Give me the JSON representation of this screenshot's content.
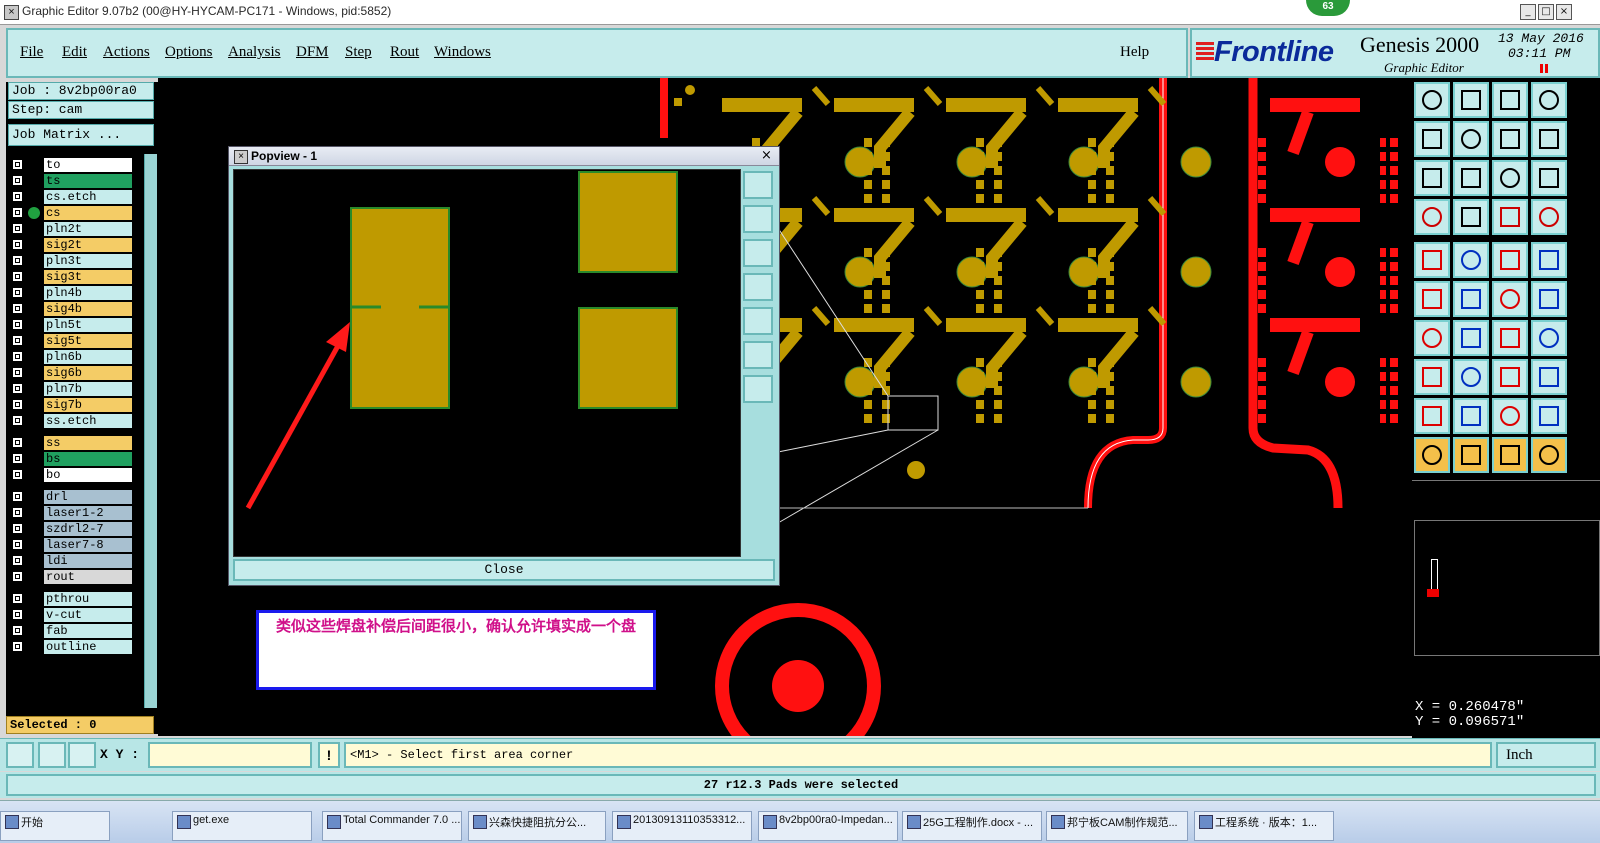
{
  "window": {
    "title": "Graphic Editor 9.07b2 (00@HY-HYCAM-PC171 - Windows, pid:5852)",
    "badge": "63",
    "minimize_glyph": "_",
    "maximize_glyph": "□",
    "close_glyph": "×"
  },
  "menu": {
    "items": [
      "File",
      "Edit",
      "Actions",
      "Options",
      "Analysis",
      "DFM",
      "Step",
      "Rout",
      "Windows"
    ],
    "help": "Help"
  },
  "brand": {
    "logo": "Frontline",
    "product": "Genesis 2000",
    "subtitle": "Graphic Editor",
    "date_line1": "13 May 2016",
    "date_line2": "03:11 PM"
  },
  "job": {
    "job_label": "Job : 8v2bp00ra0",
    "step_label": "Step: cam",
    "matrix_button": "Job Matrix ..."
  },
  "layers": [
    {
      "name": "to",
      "color": "#ffffff"
    },
    {
      "name": "ts",
      "color": "#20a060"
    },
    {
      "name": "cs.etch",
      "color": "#c6ecec"
    },
    {
      "name": "cs",
      "color": "#f4cc66",
      "active": true
    },
    {
      "name": "pln2t",
      "color": "#c6ecec"
    },
    {
      "name": "sig2t",
      "color": "#f4cc66"
    },
    {
      "name": "pln3t",
      "color": "#c6ecec"
    },
    {
      "name": "sig3t",
      "color": "#f4cc66"
    },
    {
      "name": "pln4b",
      "color": "#c6ecec"
    },
    {
      "name": "sig4b",
      "color": "#f4cc66"
    },
    {
      "name": "pln5t",
      "color": "#c6ecec"
    },
    {
      "name": "sig5t",
      "color": "#f4cc66"
    },
    {
      "name": "pln6b",
      "color": "#c6ecec"
    },
    {
      "name": "sig6b",
      "color": "#f4cc66"
    },
    {
      "name": "pln7b",
      "color": "#c6ecec"
    },
    {
      "name": "sig7b",
      "color": "#f4cc66"
    },
    {
      "name": "ss.etch",
      "color": "#c6ecec"
    },
    {
      "name": "ss",
      "color": "#f4cc66"
    },
    {
      "name": "bs",
      "color": "#20a060"
    },
    {
      "name": "bo",
      "color": "#ffffff"
    },
    {
      "name": "drl",
      "color": "#a8c0d0"
    },
    {
      "name": "laser1-2",
      "color": "#a8c0d0"
    },
    {
      "name": "szdrl2-7",
      "color": "#a8c0d0"
    },
    {
      "name": "laser7-8",
      "color": "#a8c0d0"
    },
    {
      "name": "ldi",
      "color": "#a8c0d0"
    },
    {
      "name": "rout",
      "color": "#d8d8d8"
    },
    {
      "name": "pthrou",
      "color": "#c6ecec"
    },
    {
      "name": "v-cut",
      "color": "#c6ecec"
    },
    {
      "name": "fab",
      "color": "#c6ecec"
    },
    {
      "name": "outline",
      "color": "#c6ecec"
    }
  ],
  "selected": "Selected : 0",
  "popview": {
    "title": "Popview - 1",
    "close_button": "Close",
    "close_glyph": "×"
  },
  "annotation": "类似这些焊盘补偿后间距很小，确认允许填实成一个盘",
  "coords": {
    "x": "X = 0.260478\"",
    "y": "Y = 0.096571\""
  },
  "command": {
    "xy_label": "X Y :",
    "xy_value": "",
    "warn": "!",
    "message": "<M1> - Select first area corner",
    "unit": "Inch"
  },
  "status": "27 r12.3 Pads were selected",
  "taskbar": [
    "开始",
    "get.exe",
    "Total Commander 7.0 ...",
    "兴森快捷阻抗分公...",
    "20130913110353312...",
    "8v2bp00ra0-Impedan...",
    "25G工程制作.docx - ...",
    "邦宁板CAM制作规范...",
    "工程系统 · 版本：1..."
  ],
  "colors": {
    "pad_gold": "#bf9a00",
    "trace_red": "#ff1010",
    "panel_teal": "#c6ecec"
  }
}
